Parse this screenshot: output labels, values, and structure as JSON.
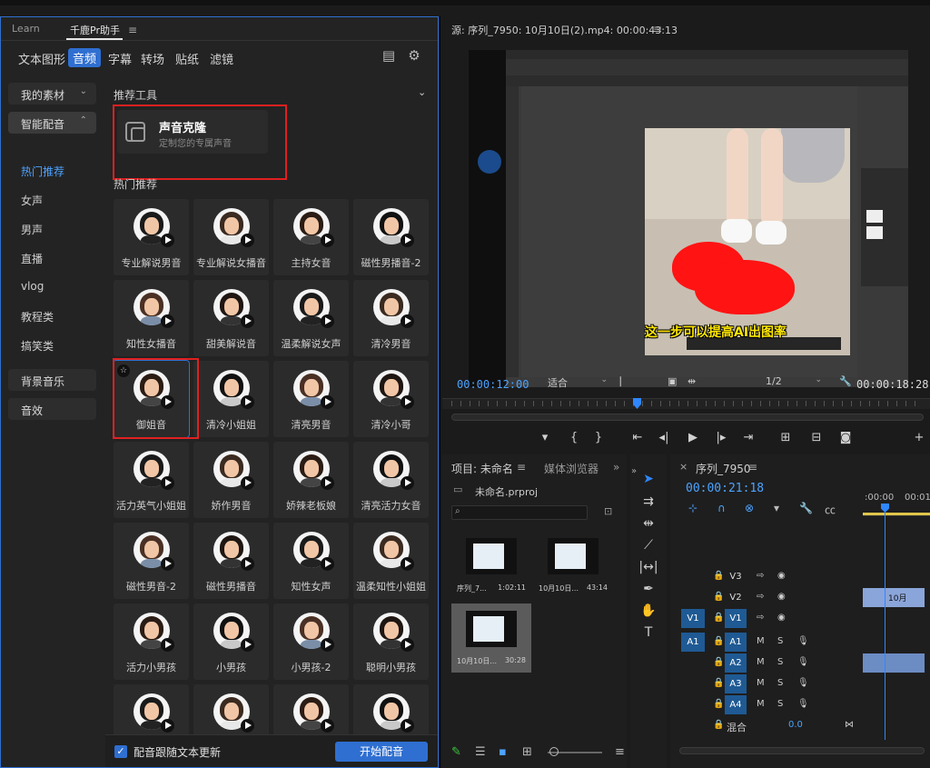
{
  "plugin": {
    "tabs": [
      "Learn",
      "千鹿Pr助手"
    ],
    "categories": [
      "文本图形",
      "音频",
      "字幕",
      "转场",
      "贴纸",
      "滤镜"
    ],
    "sidebar": {
      "my_assets": "我的素材",
      "smart_dub": "智能配音",
      "items": [
        "热门推荐",
        "女声",
        "男声",
        "直播",
        "vlog",
        "教程类",
        "搞笑类"
      ],
      "bg_music": "背景音乐",
      "sfx": "音效"
    },
    "recommended_tools_title": "推荐工具",
    "voice_clone": {
      "title": "声音克隆",
      "subtitle": "定制您的专属声音"
    },
    "hot_title": "热门推荐",
    "voices": [
      "专业解说男音",
      "专业解说女播音",
      "主持女音",
      "磁性男播音-2",
      "知性女播音",
      "甜美解说音",
      "温柔解说女声",
      "清冷男音",
      "御姐音",
      "清冷小姐姐",
      "清亮男音",
      "清冷小哥",
      "活力英气小姐姐",
      "娇作男音",
      "娇辣老板娘",
      "清亮活力女音",
      "磁性男音-2",
      "磁性男播音",
      "知性女声",
      "温柔知性小姐姐",
      "活力小男孩",
      "小男孩",
      "小男孩-2",
      "聪明小男孩",
      "",
      "",
      "",
      ""
    ],
    "follow_text_label": "配音跟随文本更新",
    "start_button": "开始配音"
  },
  "monitor": {
    "title": "源: 序列_7950: 10月10日(2).mp4: 00:00:43:13",
    "subtitle_text": "这一步可以提高AI出图率",
    "timecode_current": "00:00:12:00",
    "fit": "适合",
    "quality": "1/2",
    "timecode_duration": "00:00:18:28"
  },
  "project": {
    "tab_project": "项目: 未命名",
    "tab_media": "媒体浏览器",
    "file": "未命名.prproj",
    "items": [
      {
        "name": "序列_7...",
        "dur": "1:02:11"
      },
      {
        "name": "10月10日...",
        "dur": "43:14"
      },
      {
        "name": "10月10日...",
        "dur": "30:28"
      }
    ]
  },
  "timeline": {
    "title": "序列_7950",
    "timecode": "00:00:21:18",
    "ruler": [
      ":00:00",
      "00:01:0"
    ],
    "video_tracks": [
      "V3",
      "V2",
      "V1"
    ],
    "audio_tracks": [
      "A1",
      "A2",
      "A3",
      "A4"
    ],
    "mix_label": "混合",
    "mix_value": "0.0",
    "clip_label": "10月"
  },
  "colors": {
    "accent": "#2f6fd1",
    "highlight": "#e02020",
    "timecode": "#4da3ff"
  }
}
